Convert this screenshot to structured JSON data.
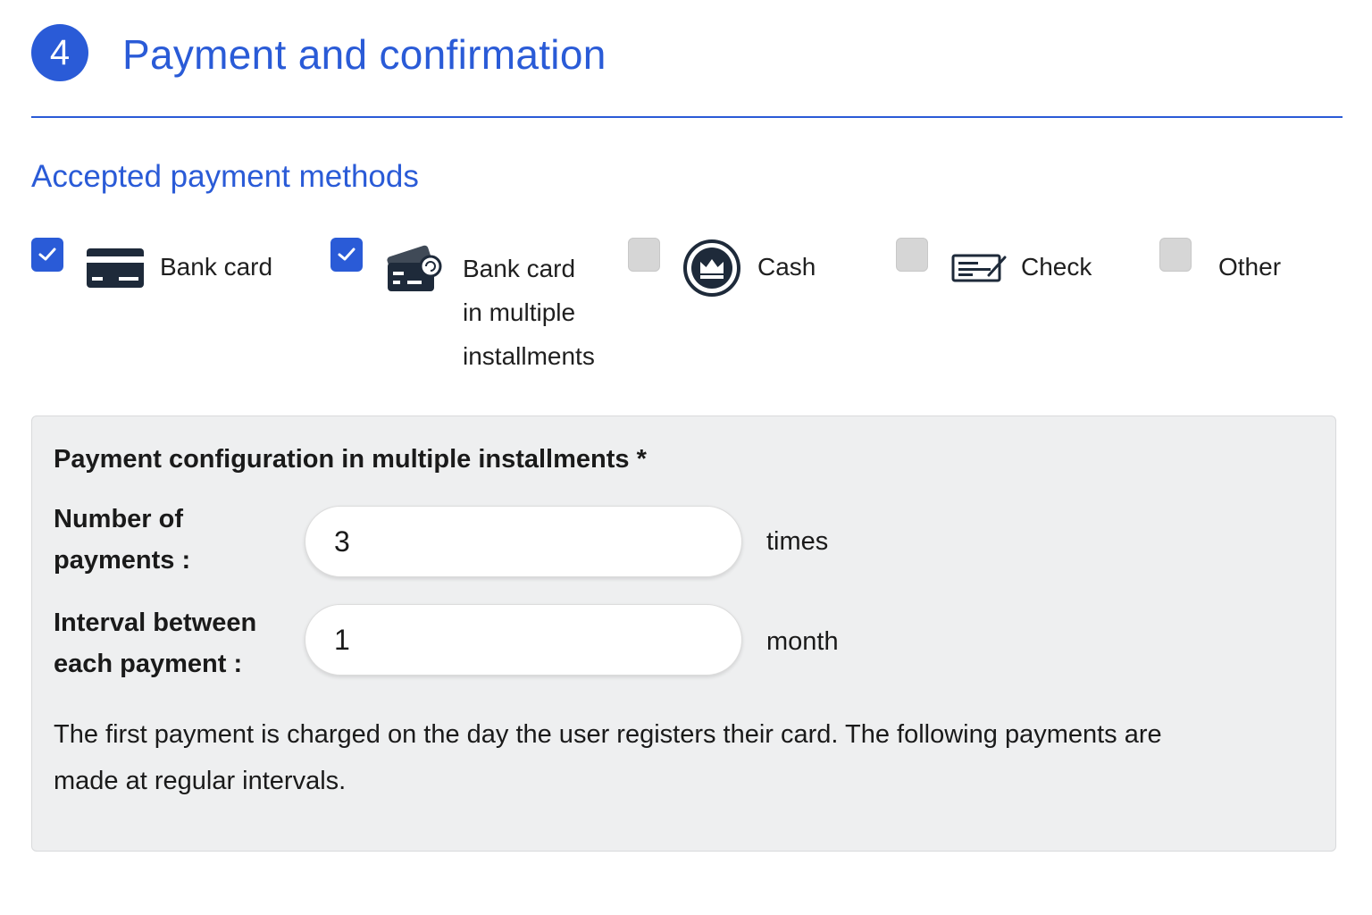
{
  "header": {
    "step_number": "4",
    "title": "Payment and confirmation"
  },
  "payment_methods": {
    "title": "Accepted payment methods",
    "items": [
      {
        "label": "Bank card",
        "checked": true,
        "icon": "credit-card-icon"
      },
      {
        "label_lines": [
          "Bank card",
          "in multiple",
          "installments"
        ],
        "checked": true,
        "icon": "installment-card-icon"
      },
      {
        "label": "Cash",
        "checked": false,
        "icon": "cash-crown-icon"
      },
      {
        "label": "Check",
        "checked": false,
        "icon": "check-cheque-icon"
      },
      {
        "label": "Other",
        "checked": false,
        "icon": null
      }
    ]
  },
  "installments_config": {
    "title": "Payment configuration in multiple installments *",
    "number_of_payments": {
      "label_lines": [
        "Number of",
        "payments :"
      ],
      "value": "3",
      "unit": "times"
    },
    "interval": {
      "label_lines": [
        "Interval between",
        "each payment :"
      ],
      "value": "1",
      "unit": "month"
    },
    "note": "The first payment is charged on the day the user registers their card. The following payments are made at regular intervals."
  },
  "colors": {
    "accent": "#2a5bd7",
    "dark_icon": "#1e2a3a",
    "unchecked_box": "#d6d6d6",
    "panel_background": "#eeeff0"
  }
}
